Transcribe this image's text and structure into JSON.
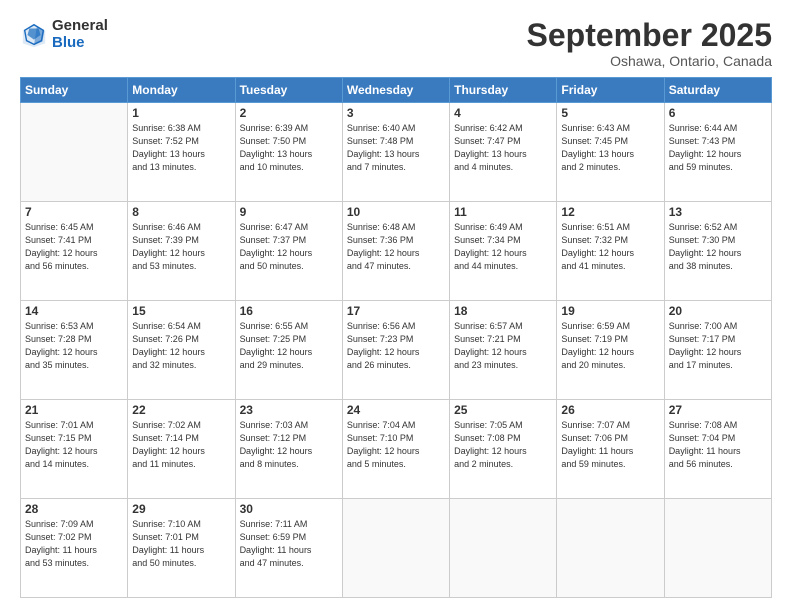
{
  "logo": {
    "general": "General",
    "blue": "Blue"
  },
  "title": {
    "month": "September 2025",
    "location": "Oshawa, Ontario, Canada"
  },
  "header": {
    "days": [
      "Sunday",
      "Monday",
      "Tuesday",
      "Wednesday",
      "Thursday",
      "Friday",
      "Saturday"
    ]
  },
  "weeks": [
    [
      {
        "day": "",
        "info": ""
      },
      {
        "day": "1",
        "info": "Sunrise: 6:38 AM\nSunset: 7:52 PM\nDaylight: 13 hours\nand 13 minutes."
      },
      {
        "day": "2",
        "info": "Sunrise: 6:39 AM\nSunset: 7:50 PM\nDaylight: 13 hours\nand 10 minutes."
      },
      {
        "day": "3",
        "info": "Sunrise: 6:40 AM\nSunset: 7:48 PM\nDaylight: 13 hours\nand 7 minutes."
      },
      {
        "day": "4",
        "info": "Sunrise: 6:42 AM\nSunset: 7:47 PM\nDaylight: 13 hours\nand 4 minutes."
      },
      {
        "day": "5",
        "info": "Sunrise: 6:43 AM\nSunset: 7:45 PM\nDaylight: 13 hours\nand 2 minutes."
      },
      {
        "day": "6",
        "info": "Sunrise: 6:44 AM\nSunset: 7:43 PM\nDaylight: 12 hours\nand 59 minutes."
      }
    ],
    [
      {
        "day": "7",
        "info": "Sunrise: 6:45 AM\nSunset: 7:41 PM\nDaylight: 12 hours\nand 56 minutes."
      },
      {
        "day": "8",
        "info": "Sunrise: 6:46 AM\nSunset: 7:39 PM\nDaylight: 12 hours\nand 53 minutes."
      },
      {
        "day": "9",
        "info": "Sunrise: 6:47 AM\nSunset: 7:37 PM\nDaylight: 12 hours\nand 50 minutes."
      },
      {
        "day": "10",
        "info": "Sunrise: 6:48 AM\nSunset: 7:36 PM\nDaylight: 12 hours\nand 47 minutes."
      },
      {
        "day": "11",
        "info": "Sunrise: 6:49 AM\nSunset: 7:34 PM\nDaylight: 12 hours\nand 44 minutes."
      },
      {
        "day": "12",
        "info": "Sunrise: 6:51 AM\nSunset: 7:32 PM\nDaylight: 12 hours\nand 41 minutes."
      },
      {
        "day": "13",
        "info": "Sunrise: 6:52 AM\nSunset: 7:30 PM\nDaylight: 12 hours\nand 38 minutes."
      }
    ],
    [
      {
        "day": "14",
        "info": "Sunrise: 6:53 AM\nSunset: 7:28 PM\nDaylight: 12 hours\nand 35 minutes."
      },
      {
        "day": "15",
        "info": "Sunrise: 6:54 AM\nSunset: 7:26 PM\nDaylight: 12 hours\nand 32 minutes."
      },
      {
        "day": "16",
        "info": "Sunrise: 6:55 AM\nSunset: 7:25 PM\nDaylight: 12 hours\nand 29 minutes."
      },
      {
        "day": "17",
        "info": "Sunrise: 6:56 AM\nSunset: 7:23 PM\nDaylight: 12 hours\nand 26 minutes."
      },
      {
        "day": "18",
        "info": "Sunrise: 6:57 AM\nSunset: 7:21 PM\nDaylight: 12 hours\nand 23 minutes."
      },
      {
        "day": "19",
        "info": "Sunrise: 6:59 AM\nSunset: 7:19 PM\nDaylight: 12 hours\nand 20 minutes."
      },
      {
        "day": "20",
        "info": "Sunrise: 7:00 AM\nSunset: 7:17 PM\nDaylight: 12 hours\nand 17 minutes."
      }
    ],
    [
      {
        "day": "21",
        "info": "Sunrise: 7:01 AM\nSunset: 7:15 PM\nDaylight: 12 hours\nand 14 minutes."
      },
      {
        "day": "22",
        "info": "Sunrise: 7:02 AM\nSunset: 7:14 PM\nDaylight: 12 hours\nand 11 minutes."
      },
      {
        "day": "23",
        "info": "Sunrise: 7:03 AM\nSunset: 7:12 PM\nDaylight: 12 hours\nand 8 minutes."
      },
      {
        "day": "24",
        "info": "Sunrise: 7:04 AM\nSunset: 7:10 PM\nDaylight: 12 hours\nand 5 minutes."
      },
      {
        "day": "25",
        "info": "Sunrise: 7:05 AM\nSunset: 7:08 PM\nDaylight: 12 hours\nand 2 minutes."
      },
      {
        "day": "26",
        "info": "Sunrise: 7:07 AM\nSunset: 7:06 PM\nDaylight: 11 hours\nand 59 minutes."
      },
      {
        "day": "27",
        "info": "Sunrise: 7:08 AM\nSunset: 7:04 PM\nDaylight: 11 hours\nand 56 minutes."
      }
    ],
    [
      {
        "day": "28",
        "info": "Sunrise: 7:09 AM\nSunset: 7:02 PM\nDaylight: 11 hours\nand 53 minutes."
      },
      {
        "day": "29",
        "info": "Sunrise: 7:10 AM\nSunset: 7:01 PM\nDaylight: 11 hours\nand 50 minutes."
      },
      {
        "day": "30",
        "info": "Sunrise: 7:11 AM\nSunset: 6:59 PM\nDaylight: 11 hours\nand 47 minutes."
      },
      {
        "day": "",
        "info": ""
      },
      {
        "day": "",
        "info": ""
      },
      {
        "day": "",
        "info": ""
      },
      {
        "day": "",
        "info": ""
      }
    ]
  ]
}
